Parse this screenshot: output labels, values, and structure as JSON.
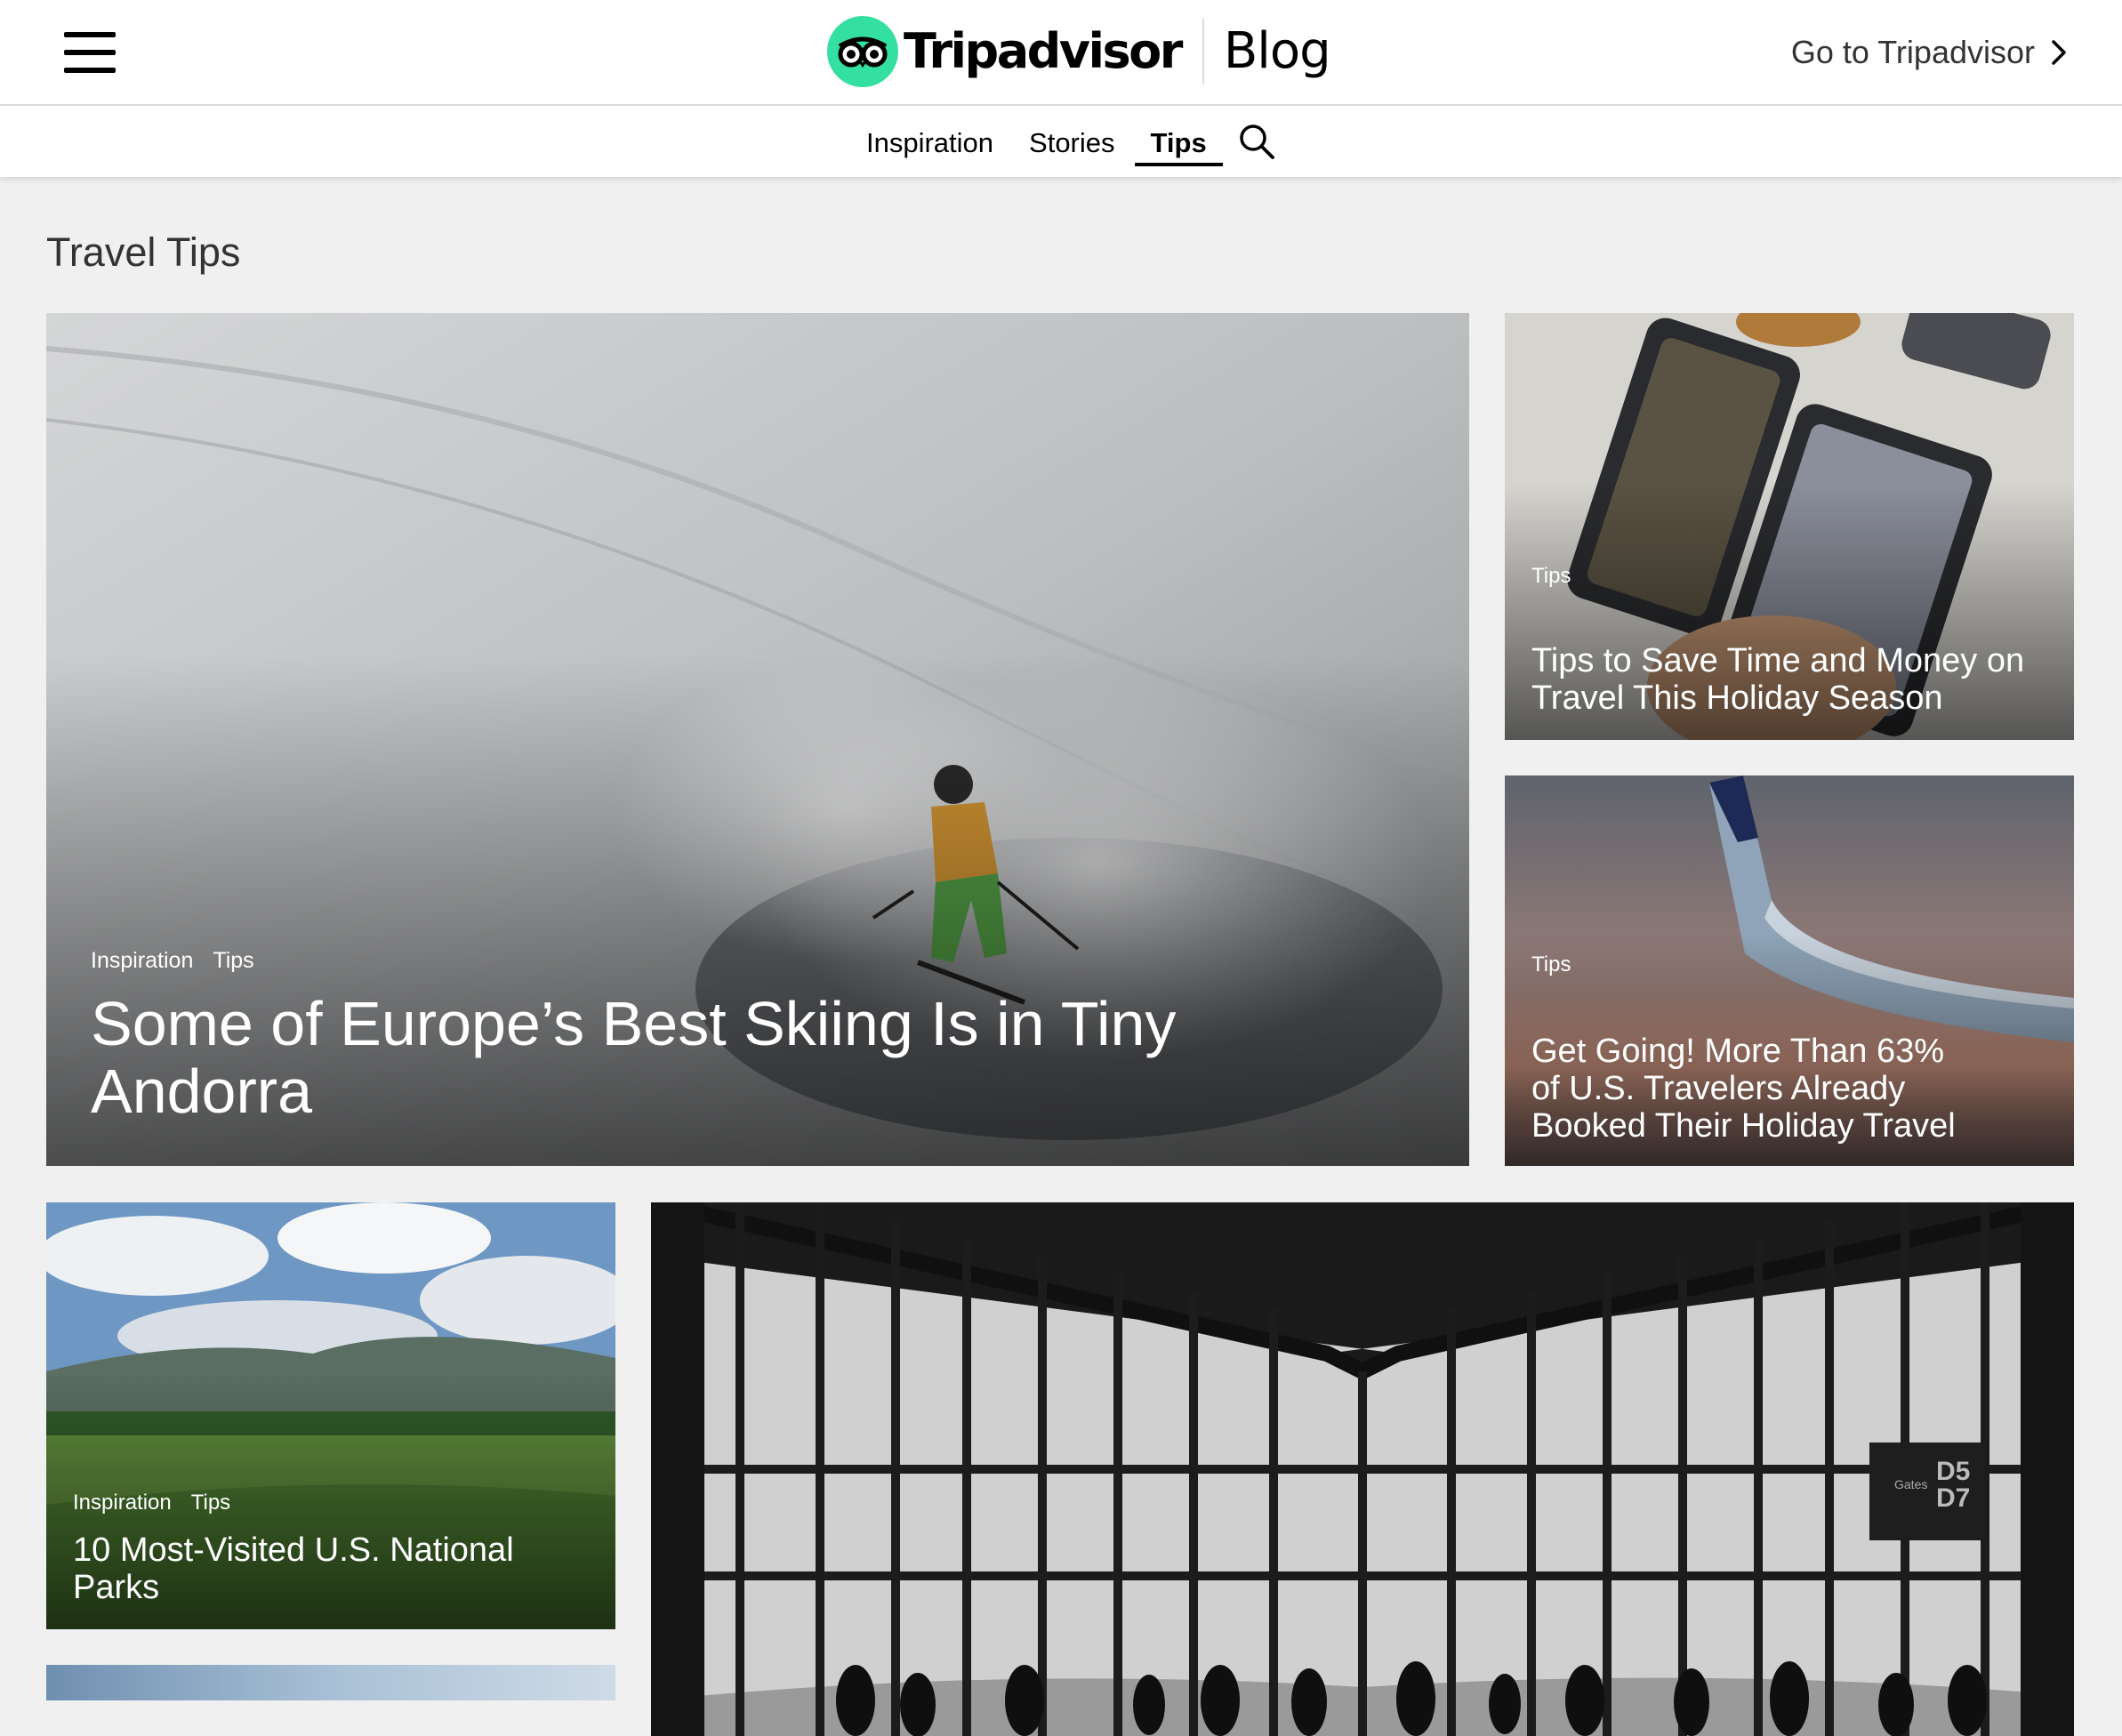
{
  "header": {
    "brand_name": "Tripadvisor",
    "brand_section": "Blog",
    "goto_label": "Go to Tripadvisor",
    "brand_color": "#34e0a1"
  },
  "nav": {
    "tabs": [
      {
        "label": "Inspiration",
        "active": false
      },
      {
        "label": "Stories",
        "active": false
      },
      {
        "label": "Tips",
        "active": true
      }
    ]
  },
  "page": {
    "title": "Travel Tips"
  },
  "articles": [
    {
      "categories": [
        "Inspiration",
        "Tips"
      ],
      "title": "Some of Europe’s Best Skiing Is in Tiny Andorra"
    },
    {
      "categories": [
        "Tips"
      ],
      "title": "Tips to Save Time and Money on Travel This Holiday Season"
    },
    {
      "categories": [
        "Tips"
      ],
      "title": "Get Going! More Than 63% of U.S. Travelers Already Booked Their Holiday Travel"
    },
    {
      "categories": [
        "Inspiration",
        "Tips"
      ],
      "title": "10 Most-Visited U.S. National Parks"
    }
  ],
  "image_text": {
    "gate_sign_label": "Gates",
    "gate_sign_line1": "D5",
    "gate_sign_line2": "D7"
  }
}
